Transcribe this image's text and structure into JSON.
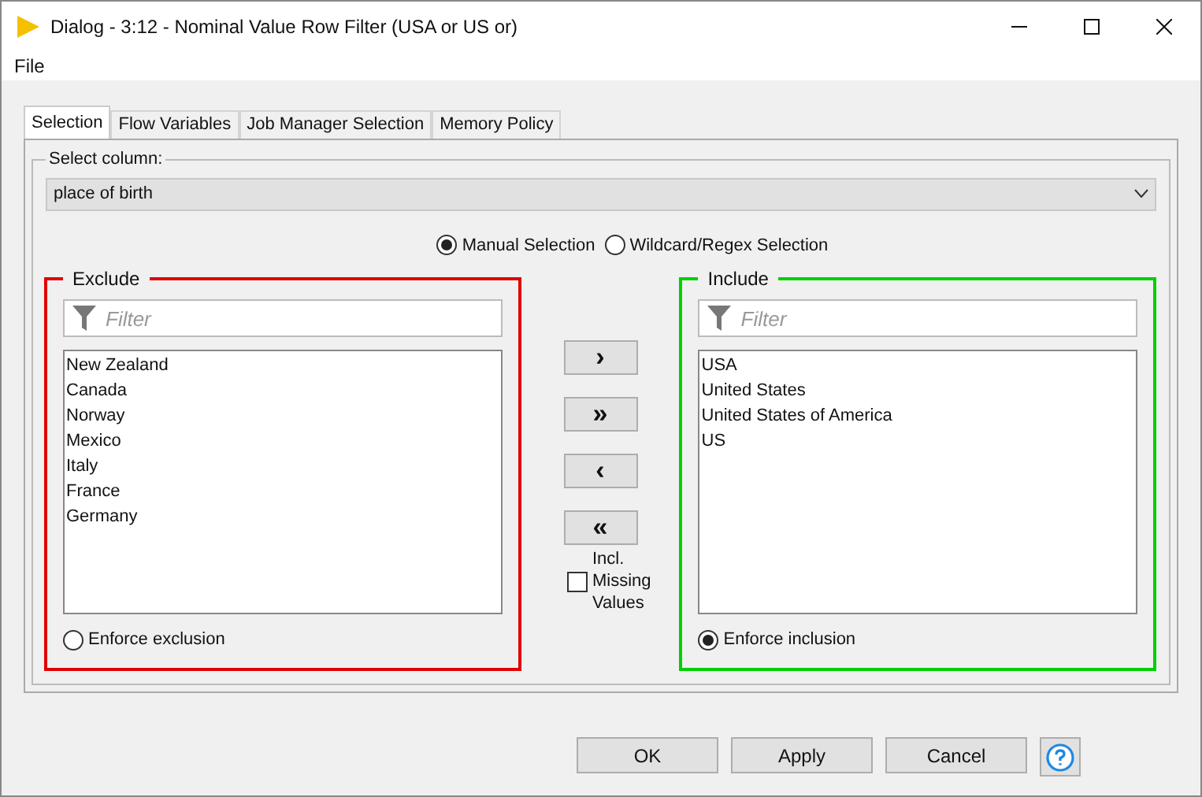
{
  "window": {
    "title": "Dialog - 3:12 - Nominal Value Row Filter (USA or US or)"
  },
  "menu": [
    "File"
  ],
  "tabs": [
    {
      "label": "Selection",
      "selected": true
    },
    {
      "label": "Flow Variables",
      "selected": false
    },
    {
      "label": "Job Manager Selection",
      "selected": false
    },
    {
      "label": "Memory Policy",
      "selected": false
    }
  ],
  "select_column": {
    "label": "Select column:",
    "value": "place of birth"
  },
  "selection_mode": [
    {
      "label": "Manual Selection",
      "selected": true
    },
    {
      "label": "Wildcard/Regex Selection",
      "selected": false
    }
  ],
  "exclude": {
    "title": "Exclude",
    "placeholder": "Filter",
    "items": [
      "New Zealand",
      "Canada",
      "Norway",
      "Mexico",
      "Italy",
      "France",
      "Germany"
    ],
    "enforce": {
      "label": "Enforce exclusion",
      "selected": false
    }
  },
  "move_buttons": [
    "›",
    "»",
    "‹",
    "«"
  ],
  "missing_values": {
    "label": "Incl. Missing Values",
    "checked": false
  },
  "include": {
    "title": "Include",
    "placeholder": "Filter",
    "items": [
      "USA",
      "United States",
      "United States of America",
      "US"
    ],
    "enforce": {
      "label": "Enforce inclusion",
      "selected": true
    }
  },
  "buttons": [
    "OK",
    "Apply",
    "Cancel"
  ]
}
